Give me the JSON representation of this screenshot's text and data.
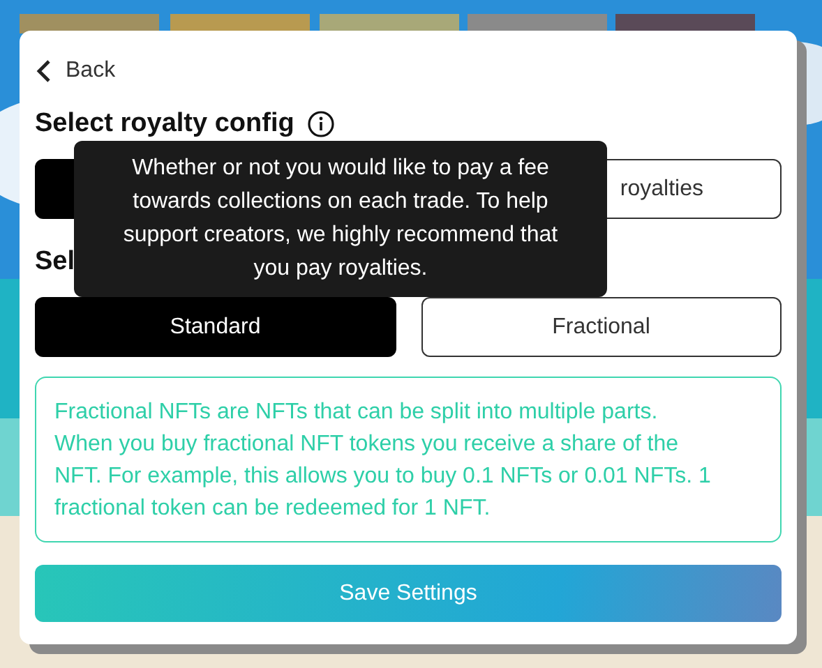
{
  "back": {
    "label": "Back"
  },
  "royalty": {
    "heading": "Select royalty config",
    "options": [
      {
        "selected": true
      },
      {
        "label": "royalties",
        "selected": false
      }
    ]
  },
  "tooltip": {
    "text": "Whether or not you would like to pay a fee towards collections on each trade. To help support creators, we highly recommend that you pay royalties."
  },
  "trade_mode": {
    "heading": "Sel",
    "options": [
      {
        "label": "Standard",
        "selected": true
      },
      {
        "label": "Fractional",
        "selected": false
      }
    ]
  },
  "info": "Fractional NFTs are NFTs that can be split into multiple parts. When you buy fractional NFT tokens you receive a share of the NFT. For example, this allows you to buy 0.1 NFTs or 0.01 NFTs. 1 fractional token can be redeemed for 1 NFT.",
  "save_button": "Save Settings"
}
